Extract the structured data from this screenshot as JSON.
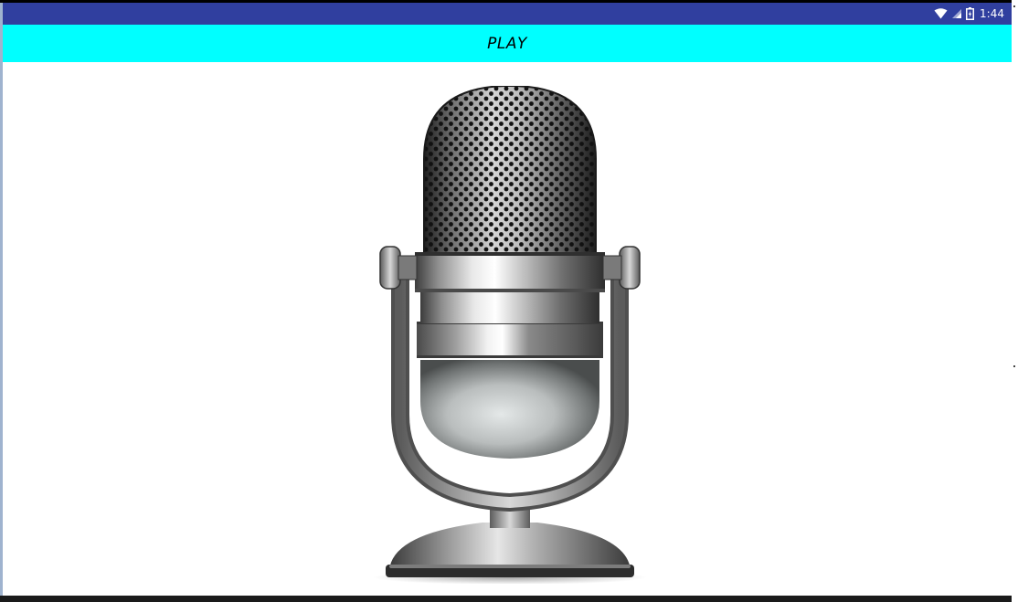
{
  "status_bar": {
    "time": "1:44",
    "icons": [
      "wifi-icon",
      "cell-signal-icon",
      "battery-icon"
    ]
  },
  "app_bar": {
    "title": "PLAY"
  },
  "main": {
    "image": "microphone-icon"
  },
  "colors": {
    "status_bar": "#303f9f",
    "app_bar": "#00ffff",
    "content": "#ffffff"
  }
}
